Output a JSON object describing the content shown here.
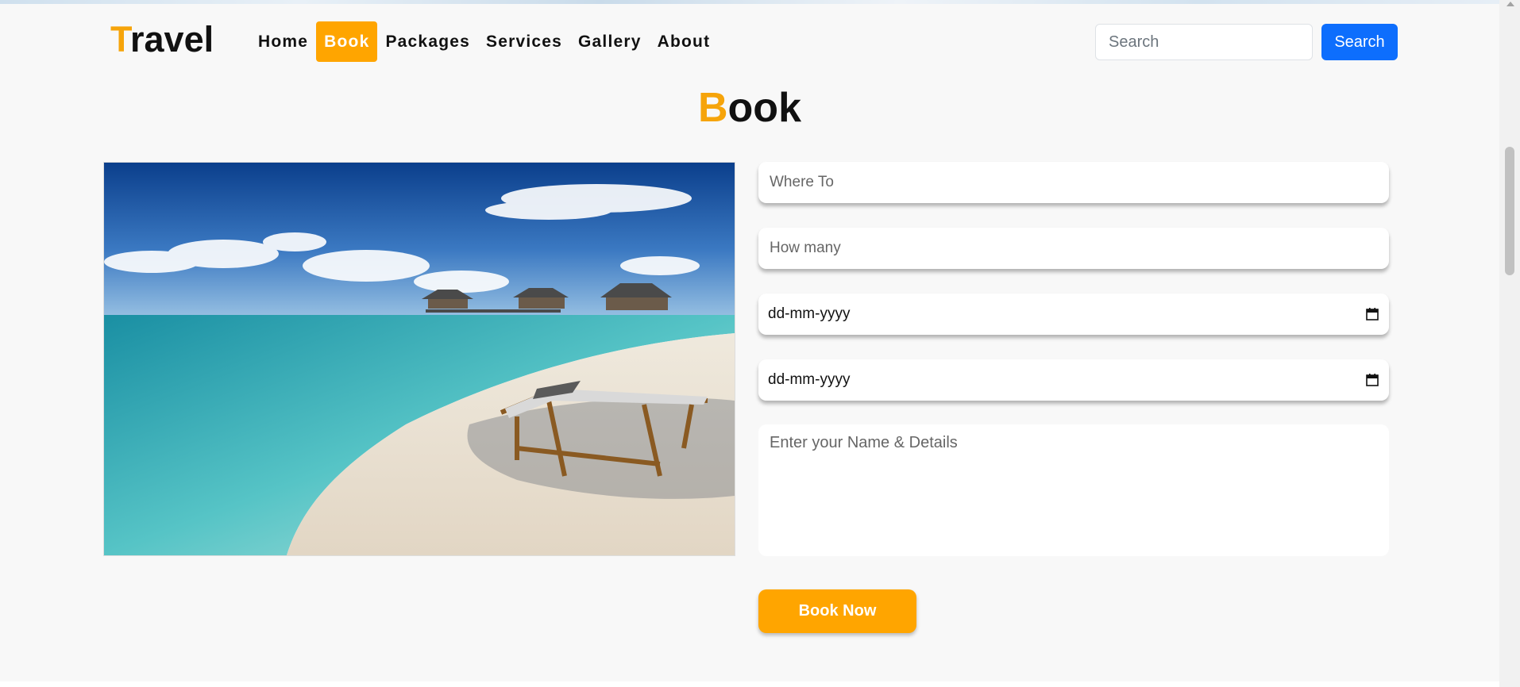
{
  "brand": {
    "logo_first": "T",
    "logo_rest": "ravel"
  },
  "nav": {
    "items": [
      {
        "label": "Home",
        "active": false
      },
      {
        "label": "Book",
        "active": true
      },
      {
        "label": "Packages",
        "active": false
      },
      {
        "label": "Services",
        "active": false
      },
      {
        "label": "Gallery",
        "active": false
      },
      {
        "label": "About",
        "active": false
      }
    ]
  },
  "search": {
    "placeholder": "Search",
    "button_label": "Search"
  },
  "heading": {
    "first": "B",
    "rest": "ook"
  },
  "form": {
    "where_placeholder": "Where To",
    "how_many_placeholder": "How many",
    "arrival_date": "dd-mm-yyyy",
    "leaving_date": "dd-mm-yyyy",
    "details_placeholder": "Enter your Name & Details",
    "submit_label": "Book Now"
  },
  "colors": {
    "accent": "#ffa500",
    "primary": "#0d6efd"
  },
  "icons": {
    "date": "calendar-icon",
    "scroll": "scroll-up-arrow-icon"
  }
}
